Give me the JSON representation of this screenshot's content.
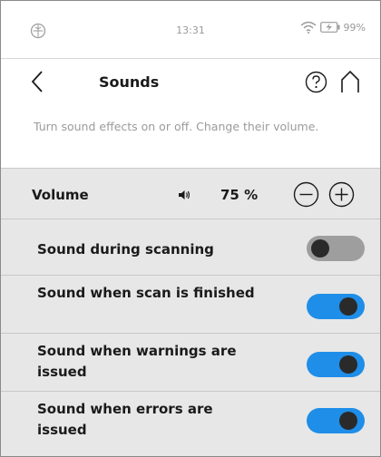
{
  "status_bar": {
    "time": "13:31",
    "battery": "99%",
    "left_icon": "globe-icon",
    "wifi_icon": "wifi-icon",
    "battery_icon": "battery-charging-icon"
  },
  "header": {
    "title": "Sounds",
    "back_icon": "chevron-left-icon",
    "help_icon": "help-circle-icon",
    "home_icon": "home-icon"
  },
  "description": "Turn sound effects on or off. Change their volume.",
  "volume": {
    "label": "Volume",
    "value": "75 %",
    "percent": 75
  },
  "settings": [
    {
      "label": "Sound during scanning",
      "enabled": false
    },
    {
      "label": "Sound when scan is finished",
      "enabled": true
    },
    {
      "label": "Sound when warnings are issued",
      "enabled": true
    },
    {
      "label": "Sound when errors are issued",
      "enabled": true
    }
  ],
  "colors": {
    "toggle_on": "#1e8ee8",
    "toggle_off": "#9e9e9e",
    "list_background": "#e7e7e7"
  }
}
